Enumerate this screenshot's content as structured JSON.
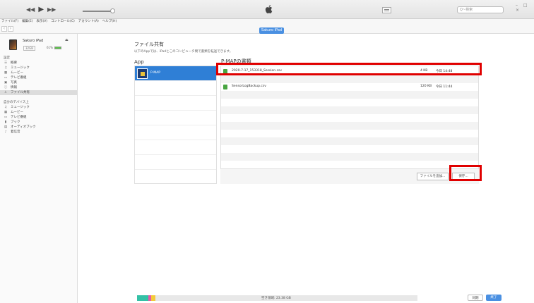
{
  "window": {
    "apple_label": "",
    "search_placeholder": "Q~検索",
    "controls": "– □ ×"
  },
  "menubar": {
    "items": [
      "ファイル(F)",
      "編集(E)",
      "表示(V)",
      "コントロール(C)",
      "アカウント(A)",
      "ヘルプ(H)"
    ]
  },
  "device_tab": "Sakuro iPad",
  "sidebar": {
    "device_name": "Sakuro iPad",
    "capacity": "32GB",
    "battery": "61%",
    "settings_heading": "設定",
    "settings_items": [
      {
        "icon": "summary-icon",
        "label": "概要"
      },
      {
        "icon": "music-icon",
        "label": "ミュージック"
      },
      {
        "icon": "movie-icon",
        "label": "ムービー"
      },
      {
        "icon": "tv-icon",
        "label": "テレビ番組"
      },
      {
        "icon": "photo-icon",
        "label": "写真"
      },
      {
        "icon": "info-icon",
        "label": "情報"
      },
      {
        "icon": "file-sharing-icon",
        "label": "ファイル共有"
      }
    ],
    "device_heading": "自分のデバイス上",
    "device_items": [
      {
        "icon": "music-icon",
        "label": "ミュージック"
      },
      {
        "icon": "movie-icon",
        "label": "ムービー"
      },
      {
        "icon": "tv-icon",
        "label": "テレビ番組"
      },
      {
        "icon": "book-icon",
        "label": "ブック"
      },
      {
        "icon": "audiobook-icon",
        "label": "オーディオブック"
      },
      {
        "icon": "ringtone-icon",
        "label": "着信音"
      }
    ]
  },
  "main": {
    "title": "ファイル共有",
    "description": "以下のAppでは、iPadとこのコンピュータ間で書類を転送できます。",
    "apps_header": "App",
    "docs_header": "P-MAPの書類",
    "apps": [
      {
        "name": "P-MAP"
      }
    ],
    "documents": [
      {
        "name": "2020-7-17_153318_Session.csv",
        "size": "4 KB",
        "date": "今日 14:48"
      },
      {
        "name": "SensorLogBackup.csv",
        "size": "120 KB",
        "date": "今日 11:44"
      }
    ],
    "add_file_button": "ファイルを追加...",
    "save_button": "保存..."
  },
  "bottom": {
    "storage_label": "空き領域: 23.38 GB",
    "sync_button": "同期",
    "done_button": "終了"
  },
  "colors": {
    "accent": "#2f7fd6",
    "highlight": "#e00000",
    "storage_segments": [
      "#34c1a6",
      "#e85aa6",
      "#f3c93b"
    ]
  }
}
